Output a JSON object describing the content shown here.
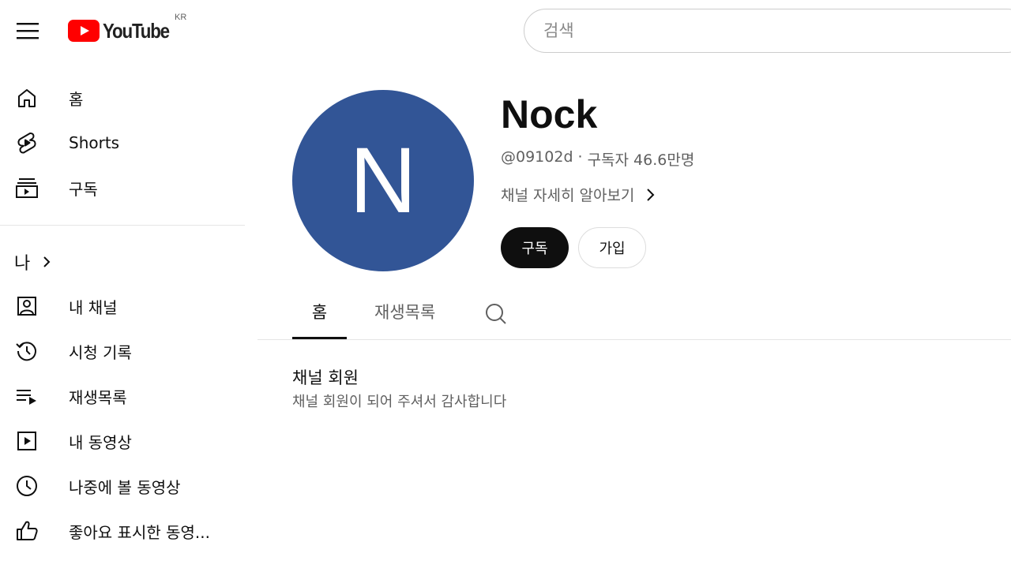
{
  "header": {
    "logo_text": "YouTube",
    "region": "KR",
    "search_placeholder": "검색"
  },
  "sidebar": {
    "main_items": [
      {
        "label": "홈",
        "icon": "home-icon"
      },
      {
        "label": "Shorts",
        "icon": "shorts-icon"
      },
      {
        "label": "구독",
        "icon": "subscriptions-icon"
      }
    ],
    "you_heading": "나",
    "you_items": [
      {
        "label": "내 채널",
        "icon": "your-channel-icon"
      },
      {
        "label": "시청 기록",
        "icon": "history-icon"
      },
      {
        "label": "재생목록",
        "icon": "playlists-icon"
      },
      {
        "label": "내 동영상",
        "icon": "your-videos-icon"
      },
      {
        "label": "나중에 볼 동영상",
        "icon": "watch-later-icon"
      },
      {
        "label": "좋아요 표시한 동영...",
        "icon": "liked-videos-icon"
      }
    ]
  },
  "channel": {
    "avatar_letter": "N",
    "avatar_color": "#325596",
    "name": "Nock",
    "handle": "@09102d",
    "separator": "·",
    "subscribers": "구독자 46.6만명",
    "more_info": "채널 자세히 알아보기",
    "subscribe_label": "구독",
    "join_label": "가입"
  },
  "tabs": [
    {
      "label": "홈",
      "active": true
    },
    {
      "label": "재생목록",
      "active": false
    }
  ],
  "membership": {
    "title": "채널 회원",
    "subtitle": "채널 회원이 되어 주셔서 감사합니다"
  },
  "colors": {
    "accent_red": "#ff0000",
    "text_primary": "#0f0f0f",
    "text_secondary": "#606060",
    "subscribe_bg": "#0f0f0f"
  }
}
